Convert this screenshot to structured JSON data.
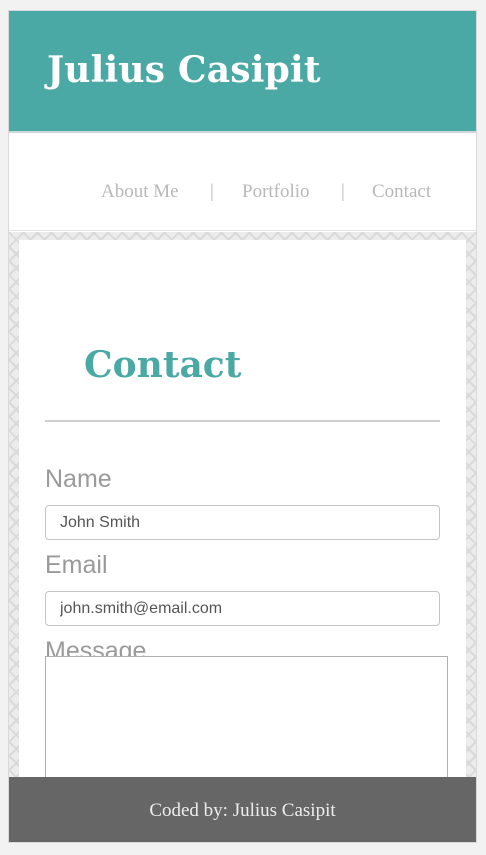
{
  "header": {
    "title": "Julius Casipit"
  },
  "nav": {
    "items": [
      {
        "label": "About Me"
      },
      {
        "label": "Portfolio"
      },
      {
        "label": "Contact"
      }
    ],
    "separator": "|"
  },
  "main": {
    "heading": "Contact",
    "form": {
      "name_label": "Name",
      "name_value": "John Smith",
      "email_label": "Email",
      "email_value": "john.smith@email.com",
      "message_label": "Message",
      "message_value": ""
    }
  },
  "footer": {
    "credit": "Coded by: Julius Casipit"
  },
  "colors": {
    "accent": "#4aa9a4",
    "footer_bg": "#666666",
    "nav_text": "#b8b8b8",
    "label_text": "#9a9a9a"
  }
}
